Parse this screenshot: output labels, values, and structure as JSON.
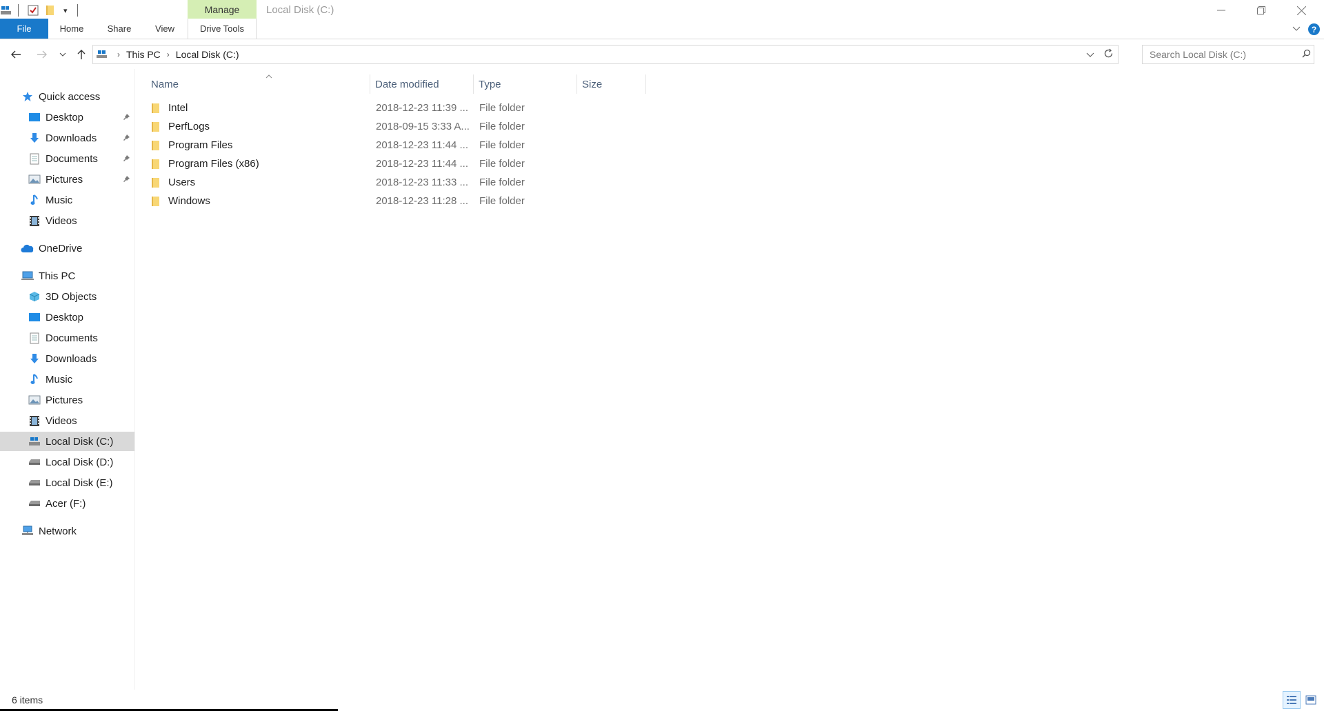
{
  "quick_access_toolbar": {
    "icons": [
      "drive-icon",
      "properties-checkbox-icon",
      "new-folder-icon",
      "customize-dropdown-icon"
    ]
  },
  "ribbon": {
    "context_tab_group": "Manage",
    "tabs": [
      {
        "label": "File"
      },
      {
        "label": "Home"
      },
      {
        "label": "Share"
      },
      {
        "label": "View"
      },
      {
        "label": "Drive Tools"
      }
    ]
  },
  "window": {
    "title": "Local Disk (C:)"
  },
  "address_bar": {
    "breadcrumbs": [
      "This PC",
      "Local Disk (C:)"
    ]
  },
  "search": {
    "placeholder": "Search Local Disk (C:)"
  },
  "navigation_pane": {
    "quick_access": {
      "label": "Quick access"
    },
    "quick_items": [
      {
        "label": "Desktop",
        "pinned": true
      },
      {
        "label": "Downloads",
        "pinned": true
      },
      {
        "label": "Documents",
        "pinned": true
      },
      {
        "label": "Pictures",
        "pinned": true
      },
      {
        "label": "Music",
        "pinned": false
      },
      {
        "label": "Videos",
        "pinned": false
      }
    ],
    "onedrive": {
      "label": "OneDrive"
    },
    "this_pc": {
      "label": "This PC"
    },
    "pc_items": [
      {
        "label": "3D Objects"
      },
      {
        "label": "Desktop"
      },
      {
        "label": "Documents"
      },
      {
        "label": "Downloads"
      },
      {
        "label": "Music"
      },
      {
        "label": "Pictures"
      },
      {
        "label": "Videos"
      },
      {
        "label": "Local Disk (C:)",
        "selected": true
      },
      {
        "label": "Local Disk (D:)"
      },
      {
        "label": "Local Disk (E:)"
      },
      {
        "label": "Acer (F:)"
      }
    ],
    "network": {
      "label": "Network"
    }
  },
  "file_list": {
    "columns": [
      "Name",
      "Date modified",
      "Type",
      "Size"
    ],
    "rows": [
      {
        "name": "Intel",
        "date": "2018-12-23 11:39 ...",
        "type": "File folder"
      },
      {
        "name": "PerfLogs",
        "date": "2018-09-15 3:33 A...",
        "type": "File folder"
      },
      {
        "name": "Program Files",
        "date": "2018-12-23 11:44 ...",
        "type": "File folder"
      },
      {
        "name": "Program Files (x86)",
        "date": "2018-12-23 11:44 ...",
        "type": "File folder"
      },
      {
        "name": "Users",
        "date": "2018-12-23 11:33 ...",
        "type": "File folder"
      },
      {
        "name": "Windows",
        "date": "2018-12-23 11:28 ...",
        "type": "File folder"
      }
    ]
  },
  "status_bar": {
    "item_count": "6 items"
  },
  "colors": {
    "file_tab": "#1979ca",
    "manage_tab": "#d5eeb4",
    "selected_nav": "#d9d9d9",
    "folder": "#f8d775"
  }
}
